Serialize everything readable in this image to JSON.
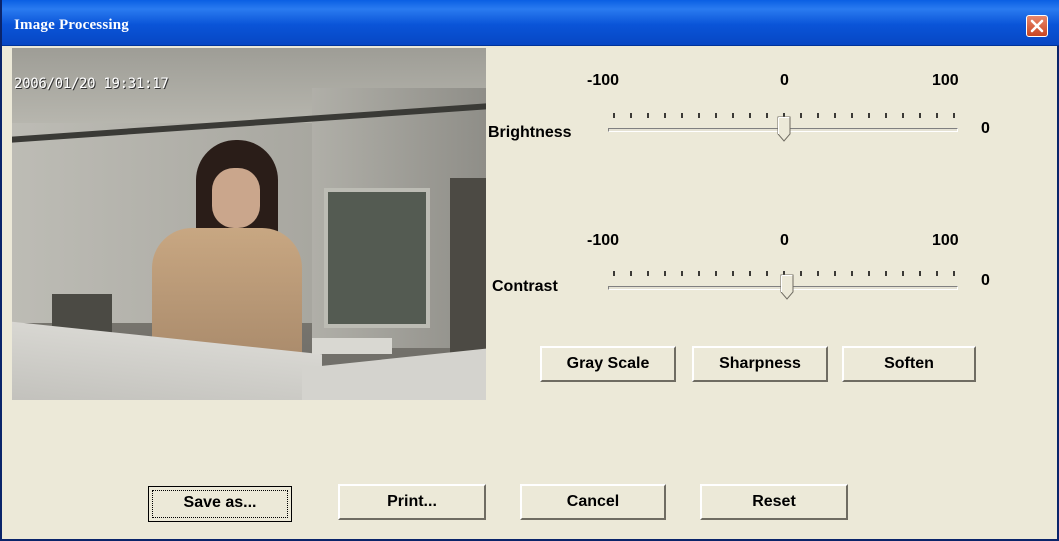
{
  "window": {
    "title": "Image Processing"
  },
  "video": {
    "timestamp": "2006/01/20 19:31:17"
  },
  "brightness": {
    "label": "Brightness",
    "min_label": "-100",
    "mid_label": "0",
    "max_label": "100",
    "value": "0"
  },
  "contrast": {
    "label": "Contrast",
    "min_label": "-100",
    "mid_label": "0",
    "max_label": "100",
    "value": "0"
  },
  "effects": {
    "gray_scale": "Gray Scale",
    "sharpness": "Sharpness",
    "soften": "Soften"
  },
  "actions": {
    "save_as": "Save as...",
    "print": "Print...",
    "cancel": "Cancel",
    "reset": "Reset"
  },
  "colors": {
    "titlebar": "#0a54d8",
    "face": "#ece9d8",
    "close": "#c94622"
  },
  "icons": {
    "close": "close-icon"
  }
}
